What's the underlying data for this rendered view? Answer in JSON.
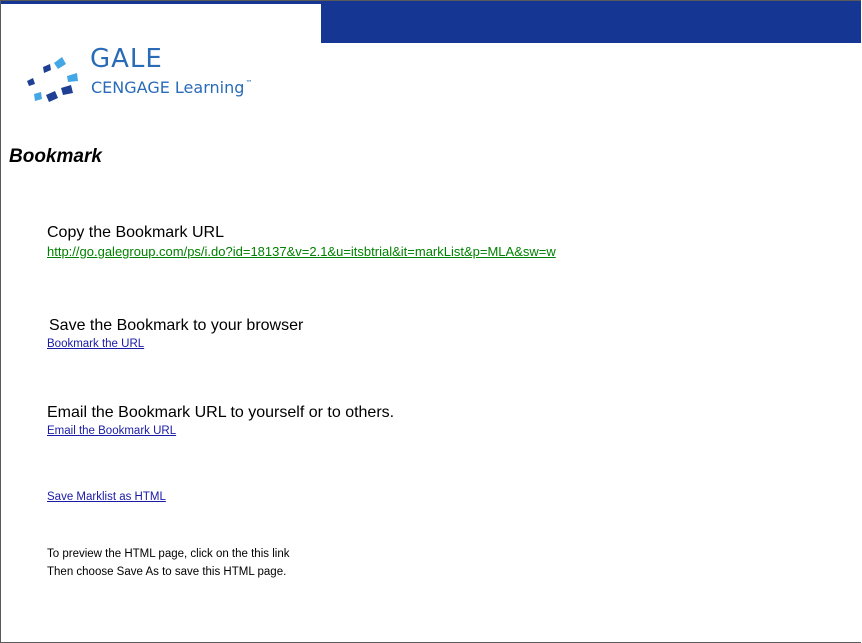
{
  "header": {
    "brand_color": "#163694"
  },
  "logo": {
    "name": "GALE",
    "subname": "CENGAGE Learning",
    "tm": "™",
    "color": "#2a6bb8"
  },
  "page": {
    "title": "Bookmark"
  },
  "copy_section": {
    "heading": "Copy the Bookmark URL",
    "url": "http://go.galegroup.com/ps/i.do?id=18137&v=2.1&u=itsbtrial&it=markList&p=MLA&sw=w"
  },
  "save_section": {
    "heading": "Save the Bookmark to your browser",
    "link": "Bookmark the URL"
  },
  "email_section": {
    "heading": "Email the Bookmark URL to yourself or to others.",
    "link": "Email the Bookmark URL"
  },
  "html_section": {
    "link": "Save Marklist as HTML"
  },
  "instructions": {
    "line1": "To preview the HTML page, click on the this link",
    "line2": "Then choose Save As to save this HTML page."
  }
}
